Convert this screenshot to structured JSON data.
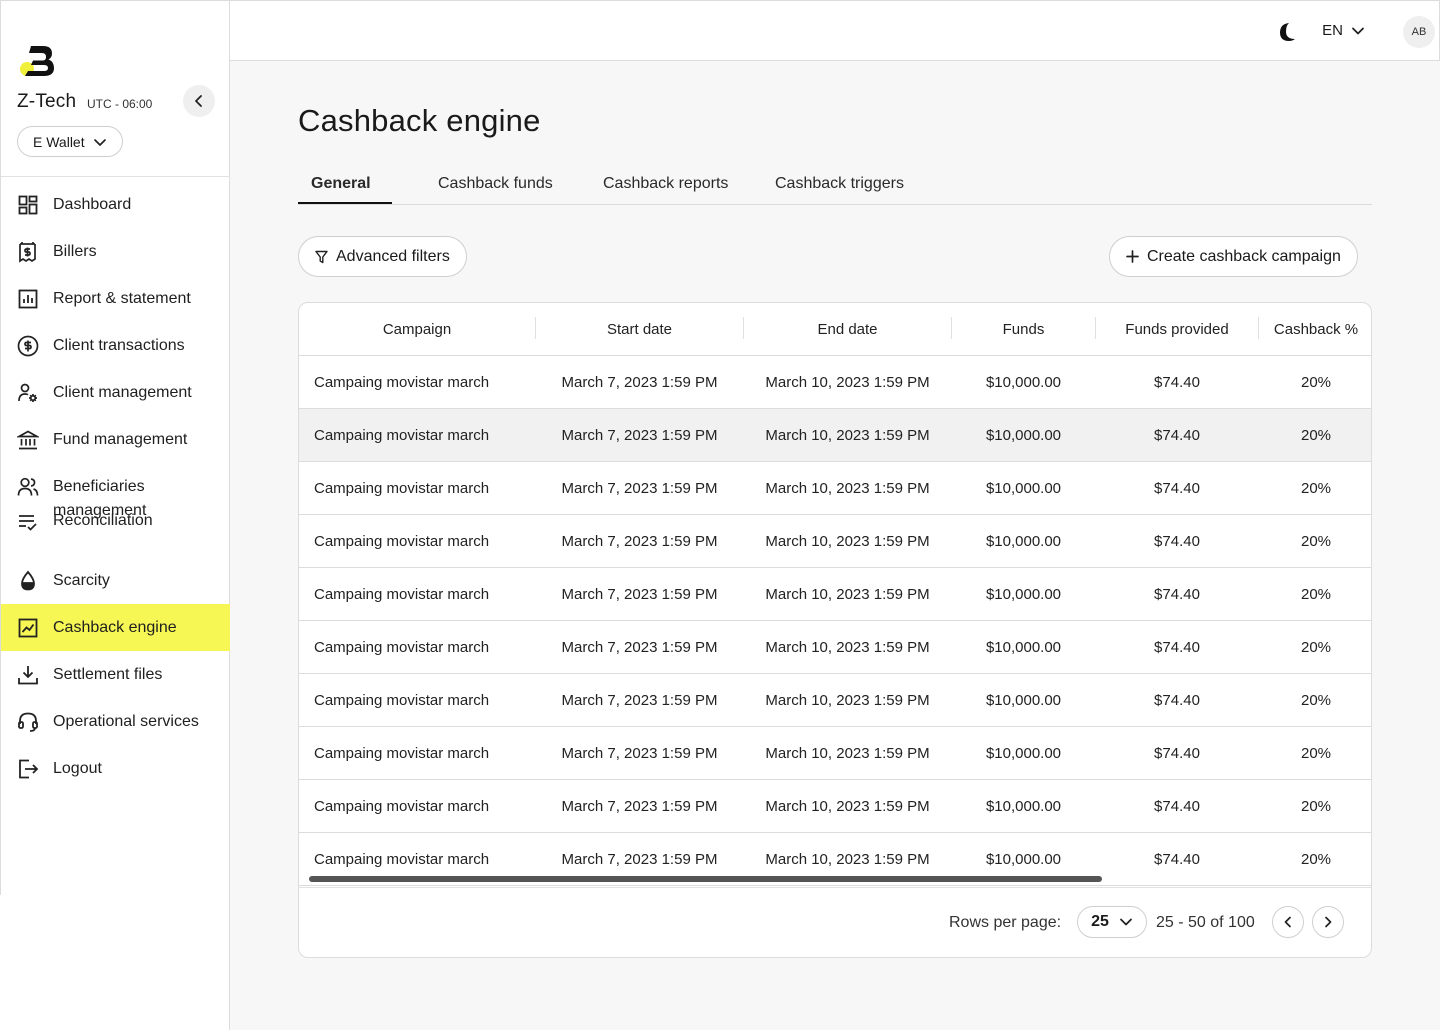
{
  "org": {
    "name": "Z-Tech",
    "timezone": "UTC - 06:00",
    "wallet": "E Wallet"
  },
  "nav": [
    {
      "label": "Dashboard",
      "icon": "dashboard-icon"
    },
    {
      "label": "Billers",
      "icon": "biller-icon"
    },
    {
      "label": "Report & statement",
      "icon": "report-icon"
    },
    {
      "label": "Client transactions",
      "icon": "dollar-circle-icon"
    },
    {
      "label": "Client management",
      "icon": "user-gear-icon"
    },
    {
      "label": "Fund management",
      "icon": "bank-icon"
    },
    {
      "label": "Beneficiaries management",
      "icon": "users-icon"
    },
    {
      "label": "Reconciliation",
      "icon": "checklist-icon"
    },
    {
      "label": "Scarcity",
      "icon": "drop-icon"
    },
    {
      "label": "Cashback engine",
      "icon": "chart-icon"
    },
    {
      "label": "Settlement files",
      "icon": "download-icon"
    },
    {
      "label": "Operational services",
      "icon": "headset-icon"
    },
    {
      "label": "Logout",
      "icon": "logout-icon"
    }
  ],
  "topbar": {
    "language": "EN",
    "avatar": "AB"
  },
  "page": {
    "title": "Cashback engine"
  },
  "tabs": [
    "General",
    "Cashback funds",
    "Cashback reports",
    "Cashback triggers"
  ],
  "actions": {
    "filters": "Advanced filters",
    "create": "Create cashback campaign"
  },
  "table": {
    "columns": [
      "Campaign",
      "Start date",
      "End date",
      "Funds",
      "Funds provided",
      "Cashback %"
    ],
    "rows": [
      [
        "Campaing movistar march",
        "March 7, 2023 1:59 PM",
        "March 10, 2023 1:59 PM",
        "$10,000.00",
        "$74.40",
        "20%"
      ],
      [
        "Campaing movistar march",
        "March 7, 2023 1:59 PM",
        "March 10, 2023 1:59 PM",
        "$10,000.00",
        "$74.40",
        "20%"
      ],
      [
        "Campaing movistar march",
        "March 7, 2023 1:59 PM",
        "March 10, 2023 1:59 PM",
        "$10,000.00",
        "$74.40",
        "20%"
      ],
      [
        "Campaing movistar march",
        "March 7, 2023 1:59 PM",
        "March 10, 2023 1:59 PM",
        "$10,000.00",
        "$74.40",
        "20%"
      ],
      [
        "Campaing movistar march",
        "March 7, 2023 1:59 PM",
        "March 10, 2023 1:59 PM",
        "$10,000.00",
        "$74.40",
        "20%"
      ],
      [
        "Campaing movistar march",
        "March 7, 2023 1:59 PM",
        "March 10, 2023 1:59 PM",
        "$10,000.00",
        "$74.40",
        "20%"
      ],
      [
        "Campaing movistar march",
        "March 7, 2023 1:59 PM",
        "March 10, 2023 1:59 PM",
        "$10,000.00",
        "$74.40",
        "20%"
      ],
      [
        "Campaing movistar march",
        "March 7, 2023 1:59 PM",
        "March 10, 2023 1:59 PM",
        "$10,000.00",
        "$74.40",
        "20%"
      ],
      [
        "Campaing movistar march",
        "March 7, 2023 1:59 PM",
        "March 10, 2023 1:59 PM",
        "$10,000.00",
        "$74.40",
        "20%"
      ],
      [
        "Campaing movistar march",
        "March 7, 2023 1:59 PM",
        "March 10, 2023 1:59 PM",
        "$10,000.00",
        "$74.40",
        "20%"
      ]
    ]
  },
  "pagination": {
    "rows_per_page_label": "Rows per page:",
    "rows_per_page": "25",
    "range": "25 - 50 of 100"
  },
  "colors": {
    "accent": "#f6f654",
    "logo_yellow": "#f0f03c"
  }
}
